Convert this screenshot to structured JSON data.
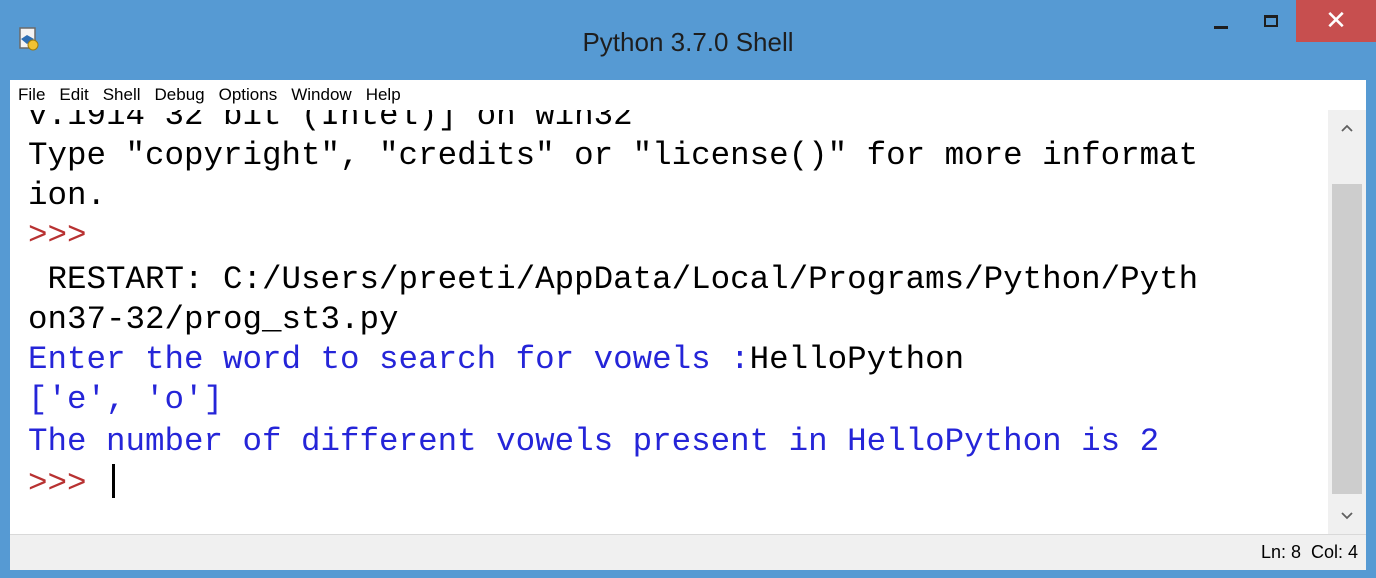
{
  "window": {
    "title": "Python 3.7.0 Shell",
    "close_glyph": "✕"
  },
  "menu": [
    "File",
    "Edit",
    "Shell",
    "Debug",
    "Options",
    "Window",
    "Help"
  ],
  "shell": {
    "lines": [
      "v.1914 32 bit (Intel)] on win32",
      "Type \"copyright\", \"credits\" or \"license()\" for more informat",
      "ion.",
      ">>> ",
      " RESTART: C:/Users/preeti/AppData/Local/Programs/Python/Pyth",
      "on37-32/prog_st3.py",
      "Enter the word to search for vowels :",
      "HelloPython",
      "['e', 'o']",
      "The number of different vowels present in HelloPython is 2",
      ">>> "
    ]
  },
  "status": {
    "position": "Ln: 8  Col: 4"
  },
  "colors": {
    "titlebar": "#569ad3",
    "close_button": "#c74f4f",
    "output_text": "#2525d8",
    "prompt": "#b83232"
  },
  "icons": {
    "app": "idle-shell-icon",
    "minimize": "minimize-icon",
    "maximize": "maximize-icon",
    "close": "close-icon",
    "scroll_up": "chevron-up-icon",
    "scroll_down": "chevron-down-icon"
  }
}
